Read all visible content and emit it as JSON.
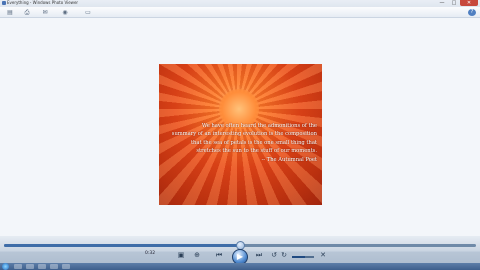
{
  "window": {
    "title": "Everything - Windows Photo Viewer",
    "minimize_glyph": "—",
    "maximize_glyph": "□",
    "close_glyph": "✕"
  },
  "toolbar": {
    "items": [
      {
        "name": "file",
        "icon": "document-icon",
        "glyph": "▤"
      },
      {
        "name": "print",
        "icon": "print-icon",
        "glyph": "⎙"
      },
      {
        "name": "email",
        "icon": "email-icon",
        "glyph": "✉"
      },
      {
        "name": "burn",
        "icon": "disc-icon",
        "glyph": "◉"
      },
      {
        "name": "open",
        "icon": "folder-icon",
        "glyph": "▭"
      }
    ],
    "help_glyph": "?"
  },
  "photo": {
    "quote": "We have often heard the admonitions of the\nsummary of an interesting evolution is the composition\nthat the sea of petals is the one small thing that\nstretches the sun to the stuff of our moments.\n-- The Autumnal Poet"
  },
  "controls": {
    "time": "0:32",
    "seek_fraction": 0.5,
    "volume_fraction": 0.6,
    "buttons": {
      "play_glyph": "▶",
      "prev_glyph": "⏮",
      "next_glyph": "⏭",
      "rotate_left_glyph": "↺",
      "rotate_right_glyph": "↻",
      "delete_glyph": "✕",
      "zoom_glyph": "⊕",
      "fit_glyph": "▣",
      "mute_glyph": "🔈"
    }
  },
  "colors": {
    "accent": "#3f6da8",
    "close": "#c7483c",
    "taskbar": "#3e5f8c"
  }
}
